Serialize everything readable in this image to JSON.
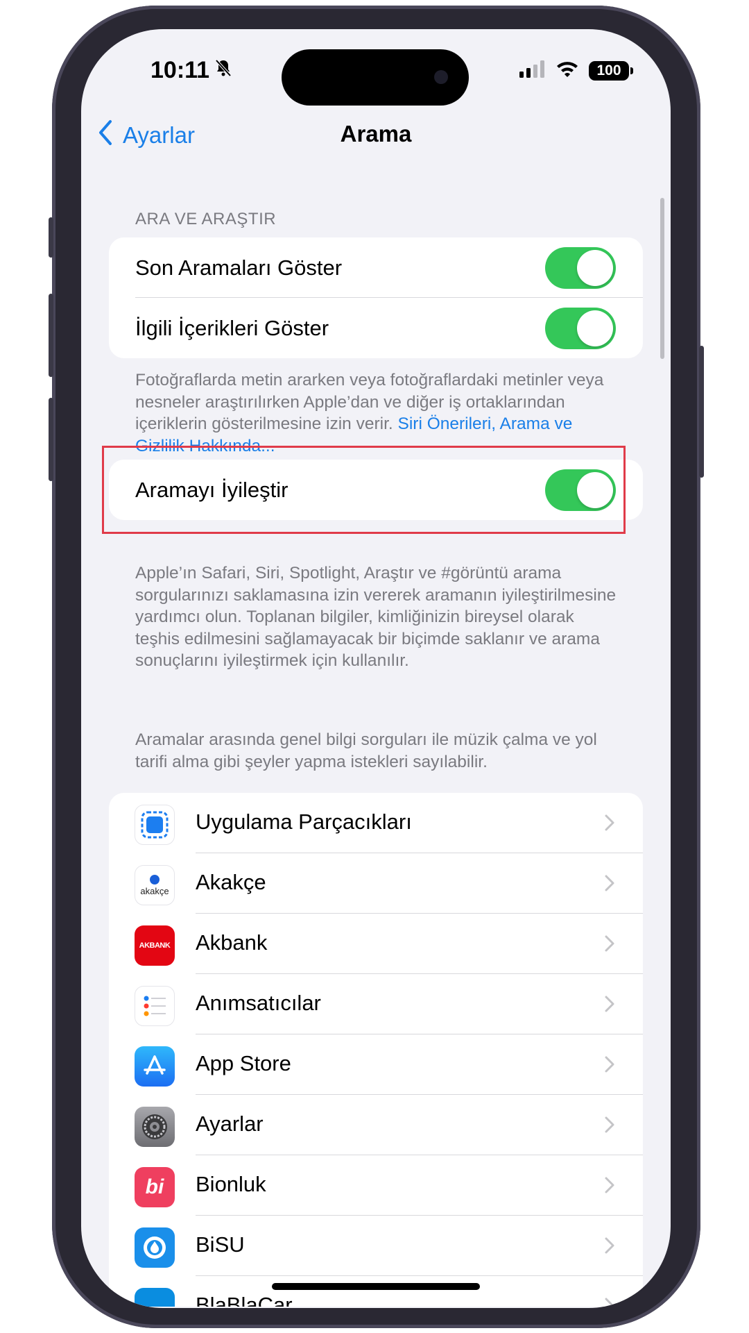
{
  "status": {
    "time": "10:11",
    "battery": "100"
  },
  "nav": {
    "back_label": "Ayarlar",
    "title": "Arama"
  },
  "section": {
    "header": "ARA VE ARAŞTIR",
    "toggles": [
      {
        "label": "Son Aramaları Göster",
        "on": true
      },
      {
        "label": "İlgili İçerikleri Göster",
        "on": true
      }
    ],
    "footnote": "Fotoğraflarda metin ararken veya fotoğraflardaki metinler veya nesneler araştırılırken Apple’dan ve diğer iş ortaklarından içeriklerin gösterilmesine izin verir. ",
    "footnote_link": "Siri Önerileri, Arama ve Gizlilik Hakkında..."
  },
  "improve": {
    "label": "Aramayı İyileştir",
    "on": true,
    "footnote1": "Apple’ın Safari, Siri, Spotlight, Araştır ve #görüntü arama sorgularınızı saklamasına izin vererek aramanın iyileştirilmesine yardımcı olun. Toplanan bilgiler, kimliğinizin bireysel olarak teşhis edilmesini sağlamayacak bir biçimde saklanır ve arama sonuçlarını iyileştirmek için kullanılır.",
    "footnote2": "Aramalar arasında genel bilgi sorguları ile müzik çalma ve yol tarifi alma gibi şeyler yapma istekleri sayılabilir."
  },
  "apps": [
    {
      "label": "Uygulama Parçacıkları",
      "icon": "app-clips-icon"
    },
    {
      "label": "Akakçe",
      "icon": "akakce-icon",
      "icon_text": "akakçe"
    },
    {
      "label": "Akbank",
      "icon": "akbank-icon",
      "icon_text": "AKBANK",
      "color": "#e30613"
    },
    {
      "label": "Anımsatıcılar",
      "icon": "reminders-icon"
    },
    {
      "label": "App Store",
      "icon": "app-store-icon",
      "color": "#1c8ef9"
    },
    {
      "label": "Ayarlar",
      "icon": "settings-icon",
      "color": "#8e8e93"
    },
    {
      "label": "Bionluk",
      "icon": "bionluk-icon",
      "icon_text": "bi",
      "color": "#ef3f5f"
    },
    {
      "label": "BiSU",
      "icon": "bisu-icon",
      "color": "#1a8fea"
    },
    {
      "label": "BlaBlaCar",
      "icon": "blablacar-icon",
      "color": "#0a8de0"
    }
  ]
}
